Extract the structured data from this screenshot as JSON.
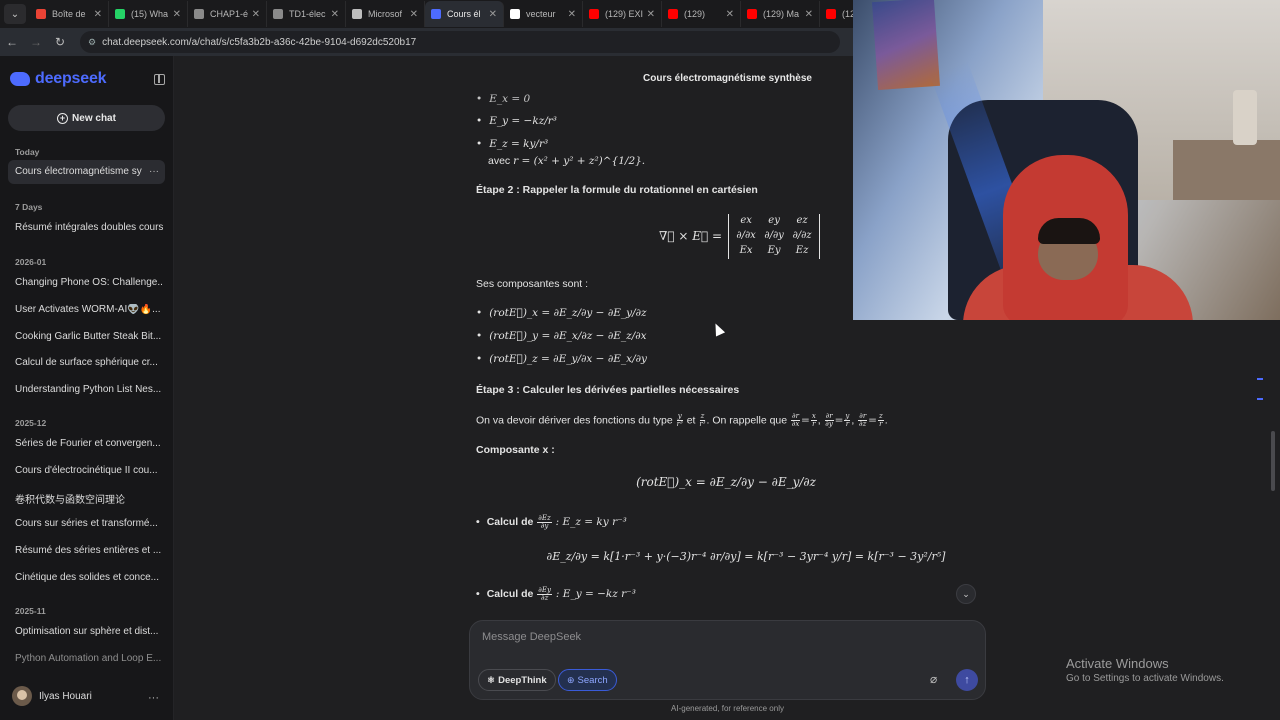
{
  "browser": {
    "tabs": [
      {
        "label": "Boîte de",
        "color": "#ea4335",
        "active": false
      },
      {
        "label": "(15) Wha",
        "color": "#25d366",
        "active": false
      },
      {
        "label": "CHAP1-é",
        "color": "#8a8a8a",
        "active": false
      },
      {
        "label": "TD1-élec",
        "color": "#8a8a8a",
        "active": false
      },
      {
        "label": "Microsof",
        "color": "#bdbdbd",
        "active": false
      },
      {
        "label": "Cours él",
        "color": "#4d6bfe",
        "active": true
      },
      {
        "label": "vecteur",
        "color": "#ffffff",
        "active": false
      },
      {
        "label": "(129) EXI",
        "color": "#ff0000",
        "active": false
      },
      {
        "label": "(129)",
        "color": "#ff0000",
        "active": false
      },
      {
        "label": "(129) Ma",
        "color": "#ff0000",
        "active": false
      },
      {
        "label": "(129",
        "color": "#ff0000",
        "active": false
      }
    ],
    "url": "chat.deepseek.com/a/chat/s/c5fa3b2b-a36c-42be-9104-d692dc520b17"
  },
  "sidebar": {
    "logo": "deepseek",
    "new_chat": "New chat",
    "sections": {
      "today": "Today",
      "seven_days": "7 Days",
      "y2026_01": "2026-01",
      "y2025_12": "2025-12",
      "y2025_11": "2025-11"
    },
    "today_items": [
      "Cours électromagnétisme sy"
    ],
    "seven_days_items": [
      "Résumé intégrales doubles cours"
    ],
    "y2026_01_items": [
      "Changing Phone OS: Challenge...",
      "User Activates WORM-AI👽🔥...",
      "Cooking Garlic Butter Steak Bit...",
      "Calcul de surface sphérique cr...",
      "Understanding Python List Nes..."
    ],
    "y2025_12_items": [
      "Séries de Fourier et convergen...",
      "Cours d'électrocinétique II cou...",
      "卷积代数与函数空间理论",
      "Cours sur séries et transformé...",
      "Résumé des séries entières et ...",
      "Cinétique des solides et conce..."
    ],
    "y2025_11_items": [
      "Optimisation sur sphère et dist...",
      "Python Automation and Loop E..."
    ],
    "user_name": "Ilyas Houari"
  },
  "main": {
    "title": "Cours électromagnétisme synthèse",
    "ex_eq": "E_x = 0",
    "ey_eq": "E_y = −kz/r³",
    "ez_eq": "E_z = ky/r³",
    "avec_text": "avec",
    "avec_eq": "r = (x² + y² + z²)^{1/2}.",
    "step2": "Étape 2 : Rappeler la formule du rotationnel en cartésien",
    "curl_lhs": "∇⃗ × E⃗ =",
    "components_intro": "Ses composantes sont :",
    "rot_x": "(rotE⃗)_x = ∂E_z/∂y − ∂E_y/∂z",
    "rot_y": "(rotE⃗)_y = ∂E_x/∂z − ∂E_z/∂x",
    "rot_z": "(rotE⃗)_z = ∂E_y/∂x − ∂E_x/∂y",
    "step3": "Étape 3 : Calculer les dérivées partielles nécessaires",
    "step3_text_a": "On va devoir dériver des fonctions du type",
    "step3_text_b": "et",
    "step3_text_c": ". On rappelle que",
    "composante_x": "Composante x :",
    "rot_x_big": "(rotE⃗)_x = ∂E_z/∂y − ∂E_y/∂z",
    "calc1_label": "Calcul de",
    "calc1_rest": ": E_z = ky r⁻³",
    "calc1_result": "∂E_z/∂y = k[1·r⁻³ + y·(−3)r⁻⁴ ∂r/∂y] = k[r⁻³ − 3yr⁻⁴ y/r] = k[r⁻³ − 3y²/r⁵]",
    "calc2_label": "Calcul de",
    "calc2_rest": ": E_y = −kz r⁻³"
  },
  "composer": {
    "placeholder": "Message DeepSeek",
    "deepthink": "DeepThink",
    "search": "Search",
    "disclaimer": "AI-generated, for reference only"
  },
  "os_overlay": {
    "activate_title": "Activate Windows",
    "activate_sub": "Go to Settings to activate Windows."
  }
}
